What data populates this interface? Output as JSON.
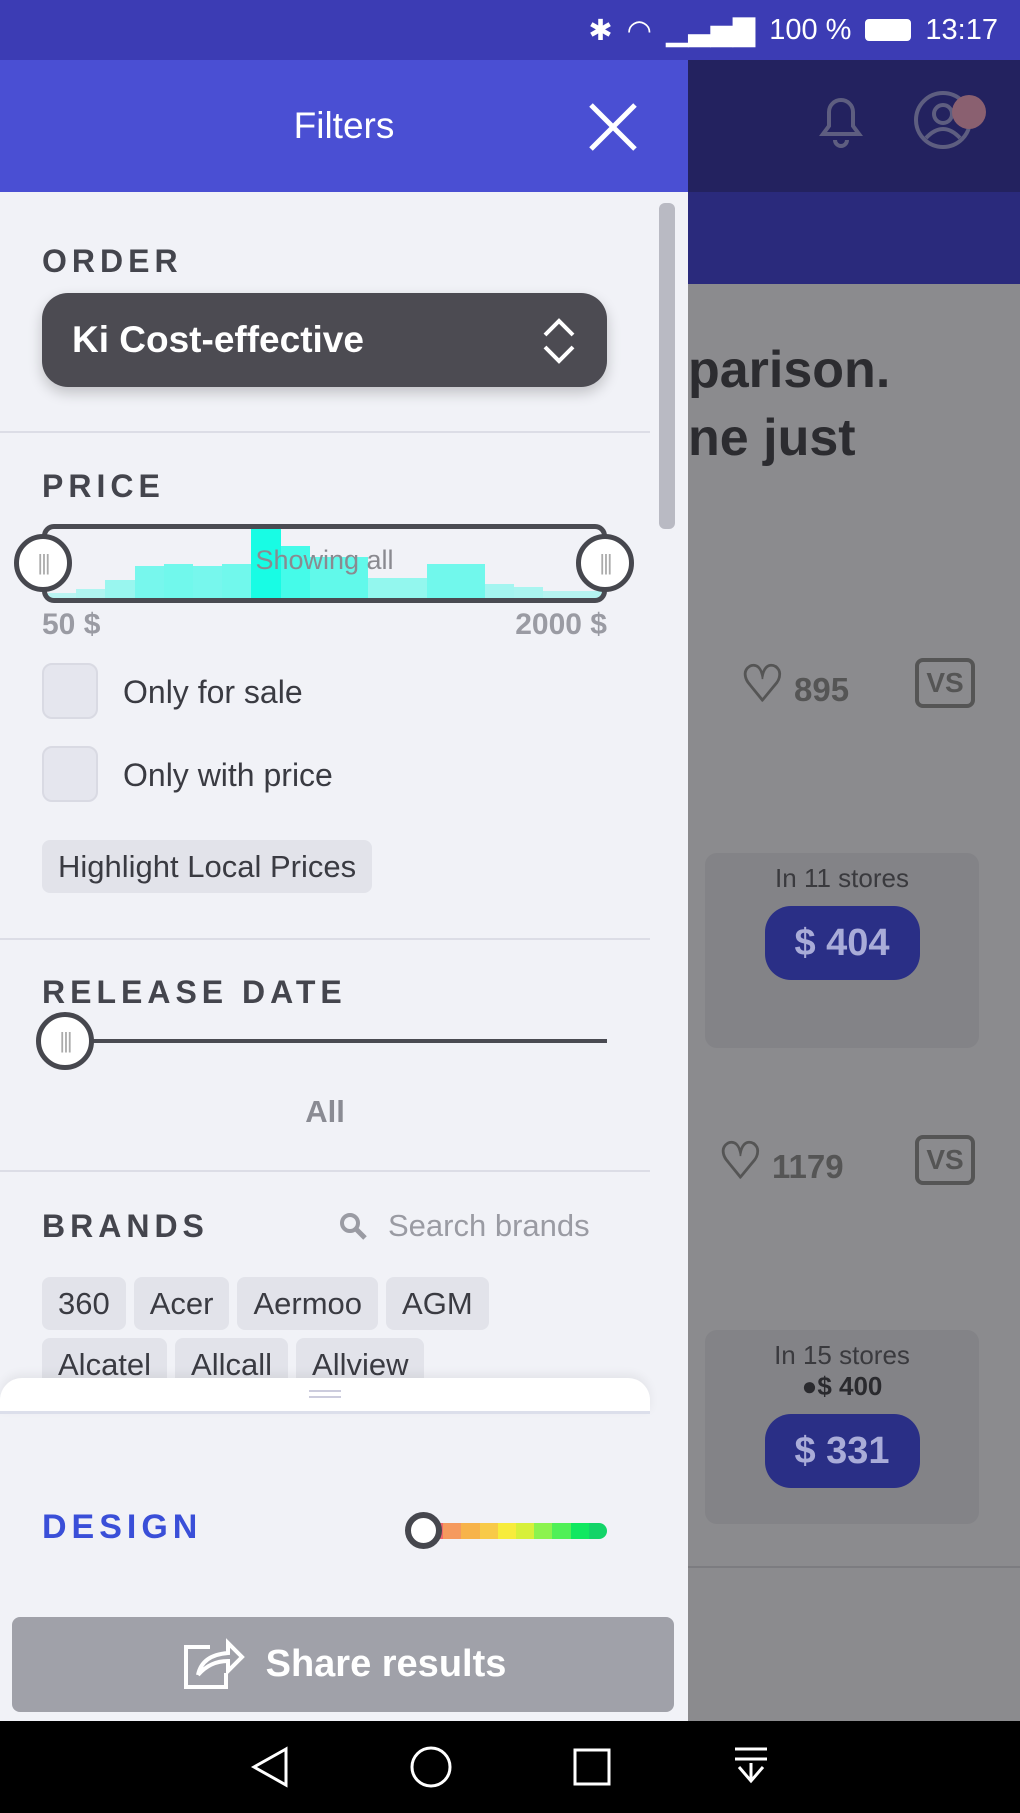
{
  "status_bar": {
    "battery": "100 %",
    "time": "13:17"
  },
  "drawer": {
    "title": "Filters",
    "order": {
      "label": "ORDER",
      "selected": "Ki Cost-effective"
    },
    "price": {
      "label": "PRICE",
      "slider_text": "Showing all",
      "min": "50 $",
      "max": "2000 $",
      "histogram": [
        2,
        4,
        8,
        14,
        15,
        14,
        15,
        31,
        23,
        18,
        18,
        9,
        9,
        15,
        15,
        6,
        5,
        3,
        3
      ],
      "checkboxes": [
        {
          "label": "Only for sale",
          "checked": false
        },
        {
          "label": "Only with price",
          "checked": false
        }
      ],
      "highlight_label": "Highlight Local Prices"
    },
    "release_date": {
      "label": "RELEASE DATE",
      "value": "All"
    },
    "brands": {
      "label": "BRANDS",
      "search_placeholder": "Search brands",
      "items": [
        "360",
        "Acer",
        "Aermoo",
        "AGM",
        "Alcatel",
        "Allcall",
        "Allview"
      ]
    },
    "design": {
      "label": "DESIGN",
      "level": 0,
      "colors": [
        "#f0686a",
        "#f59a5e",
        "#f7b34a",
        "#f8ca48",
        "#f7ec3c",
        "#d7f03a",
        "#8cf34e",
        "#50f057",
        "#10e860",
        "#13d468"
      ]
    },
    "share_label": "Share results"
  },
  "background": {
    "heading_line1": "parison.",
    "heading_line2": "ne just",
    "items": [
      {
        "likes": "895",
        "stores": "In 11 stores",
        "price": "$ 404"
      },
      {
        "likes": "1179",
        "stores": "In 15 stores",
        "local_price": "$ 400",
        "price": "$ 331"
      }
    ]
  },
  "colors": {
    "header": "#4a4fd3",
    "accent": "#3a4fd8",
    "teal": "#18fce4"
  }
}
